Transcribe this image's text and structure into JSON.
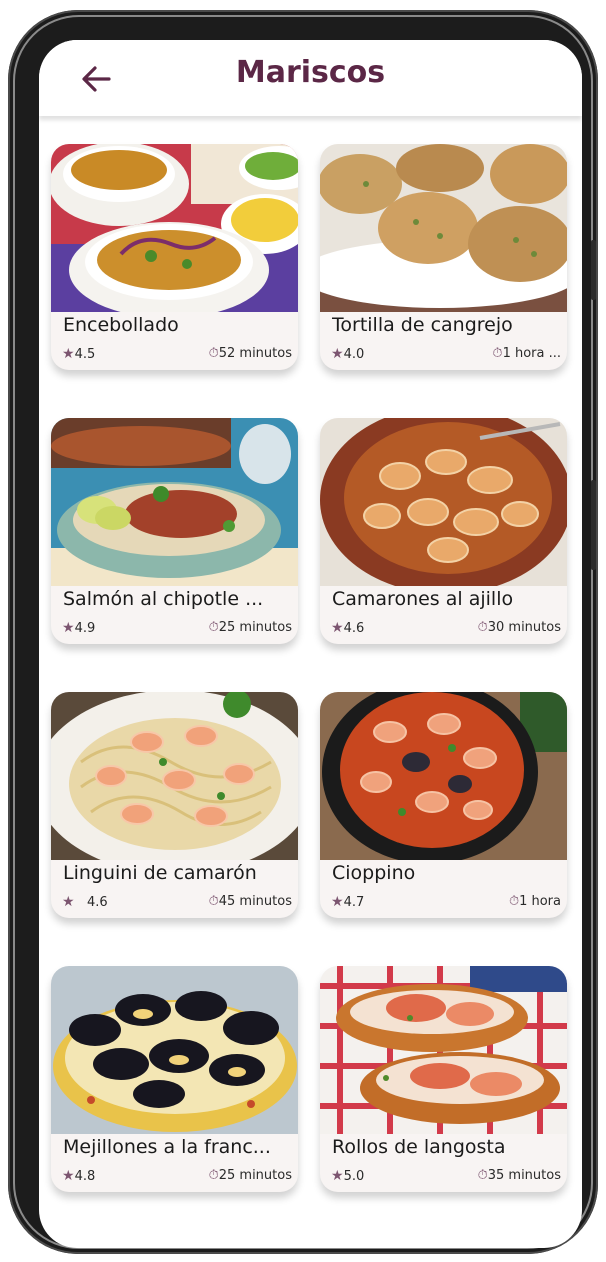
{
  "header": {
    "title": "Mariscos",
    "back_icon": "arrow-left-icon"
  },
  "colors": {
    "accent": "#5b2746",
    "card_background": "#f8f4f3",
    "icon_tint": "#7c5570"
  },
  "recipes": [
    {
      "name": "Encebollado",
      "rating": "4.5",
      "time": "52 minutos",
      "photo": "encebollado-photo"
    },
    {
      "name": "Tortilla de cangrejo",
      "rating": "4.0",
      "time": "1 hora ...",
      "photo": "crab-cakes-photo"
    },
    {
      "name": "Salmón al chipotle ...",
      "rating": "4.9",
      "time": "25 minutos",
      "photo": "salmon-bowl-photo"
    },
    {
      "name": "Camarones al ajillo",
      "rating": "4.6",
      "time": "30 minutos",
      "photo": "garlic-shrimp-photo"
    },
    {
      "name": "Linguini de camarón",
      "rating": "4.6",
      "time": "45 minutos",
      "photo": "shrimp-linguini-photo"
    },
    {
      "name": "Cioppino",
      "rating": "4.7",
      "time": "1 hora",
      "photo": "cioppino-photo"
    },
    {
      "name": "Mejillones a la franc...",
      "rating": "4.8",
      "time": "25 minutos",
      "photo": "mussels-photo"
    },
    {
      "name": "Rollos de langosta",
      "rating": "5.0",
      "time": "35 minutos",
      "photo": "lobster-rolls-photo"
    }
  ]
}
